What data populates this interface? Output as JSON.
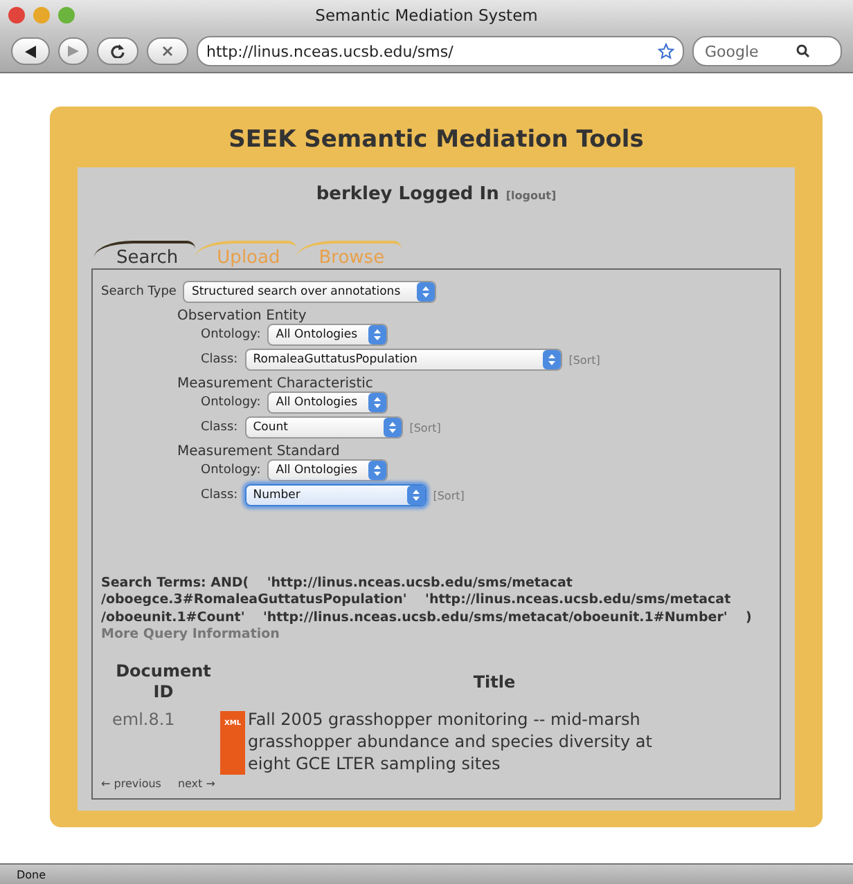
{
  "window": {
    "title": "Semantic Mediation System"
  },
  "toolbar": {
    "url": "http://linus.nceas.ucsb.edu/sms/",
    "search": {
      "placeholder": "Google"
    }
  },
  "page": {
    "title": "SEEK Semantic Mediation Tools",
    "login": "berkley Logged In",
    "logout": "[logout]"
  },
  "tabs": [
    {
      "label": "Search",
      "selected": true
    },
    {
      "label": "Upload",
      "selected": false
    },
    {
      "label": "Browse",
      "selected": false
    }
  ],
  "search_type": {
    "label": "Search Type",
    "value": "Structured search over annotations"
  },
  "groups": [
    {
      "heading": "Observation Entity",
      "ontology": {
        "label": "Ontology:",
        "value": "All Ontologies"
      },
      "class": {
        "label": "Class:",
        "value": "RomaleaGuttatusPopulation",
        "focused": false
      },
      "sort": "[Sort]"
    },
    {
      "heading": "Measurement Characteristic",
      "ontology": {
        "label": "Ontology:",
        "value": "All Ontologies"
      },
      "class": {
        "label": "Class:",
        "value": "Count",
        "focused": false
      },
      "sort": "[Sort]"
    },
    {
      "heading": "Measurement Standard",
      "ontology": {
        "label": "Ontology:",
        "value": "All Ontologies"
      },
      "class": {
        "label": "Class:",
        "value": "Number",
        "focused": true
      },
      "sort": "[Sort]"
    }
  ],
  "search_terms": [
    "Search Terms: AND(    'http://linus.nceas.ucsb.edu/sms/metacat",
    "/oboegce.3#RomaleaGuttatusPopulation'    'http://linus.nceas.ucsb.edu/sms/metacat",
    "/oboeunit.1#Count'    'http://linus.nceas.ucsb.edu/sms/metacat/oboeunit.1#Number'    )"
  ],
  "more_info": "More Query Information",
  "table": {
    "columns": [
      "Document ID",
      "Title"
    ],
    "rows": [
      {
        "id": "eml.8.1",
        "badge": "XML",
        "title": "Fall 2005 grasshopper monitoring -- mid-marsh grasshopper abundance and species diversity at eight GCE LTER sampling sites"
      }
    ]
  },
  "pager": {
    "previous": "← previous",
    "next": "next →"
  },
  "status_bar": {
    "text": "Done"
  }
}
